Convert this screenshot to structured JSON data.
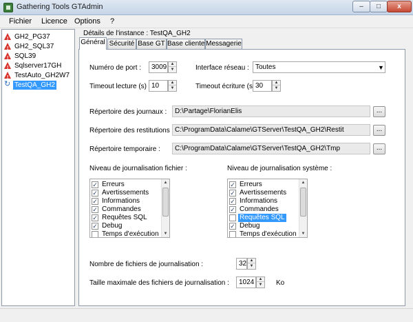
{
  "window": {
    "title": "Gathering Tools GTAdmin",
    "min": "–",
    "max": "□",
    "close": "x"
  },
  "menu": [
    "Fichier",
    "Licence",
    "Options",
    "?"
  ],
  "tree": [
    {
      "label": "GH2_PG37",
      "status": "warning"
    },
    {
      "label": "GH2_SQL37",
      "status": "warning"
    },
    {
      "label": "SQL39",
      "status": "warning"
    },
    {
      "label": "Sqlserver17GH",
      "status": "warning"
    },
    {
      "label": "TestAuto_GH2W7",
      "status": "warning"
    },
    {
      "label": "TestQA_GH2",
      "status": "refresh",
      "selected": true
    }
  ],
  "instance_title": "Détails de l'instance : TestQA_GH2",
  "tabs": [
    "Général",
    "Sécurité",
    "Base GT",
    "Base cliente",
    "Messagerie"
  ],
  "active_tab": "Général",
  "form": {
    "port": {
      "label": "Numéro de port :",
      "value": "3009"
    },
    "network": {
      "label": "Interface réseau :",
      "value": "Toutes"
    },
    "read_timeout": {
      "label": "Timeout lecture (s) :",
      "value": "10"
    },
    "write_timeout": {
      "label": "Timeout écriture (s) :",
      "value": "30"
    },
    "journal_dir": {
      "label": "Répertoire des journaux :",
      "value": "D:\\Partage\\FlorianElis"
    },
    "restit_dir": {
      "label": "Répertoire des restitutions :",
      "value": "C:\\ProgramData\\Calame\\GTServer\\TestQA_GH2\\Restit"
    },
    "temp_dir": {
      "label": "Répertoire temporaire :",
      "value": "C:\\ProgramData\\Calame\\GTServer\\TestQA_GH2\\Tmp"
    },
    "browse_label": "...",
    "file_log": {
      "title": "Niveau de journalisation fichier :",
      "items": [
        {
          "label": "Erreurs",
          "checked": true
        },
        {
          "label": "Avertissements",
          "checked": true
        },
        {
          "label": "Informations",
          "checked": true
        },
        {
          "label": "Commandes",
          "checked": true
        },
        {
          "label": "Requêtes SQL",
          "checked": true
        },
        {
          "label": "Debug",
          "checked": true
        },
        {
          "label": "Temps d'exécution",
          "checked": false
        }
      ]
    },
    "system_log": {
      "title": "Niveau de journalisation système :",
      "items": [
        {
          "label": "Erreurs",
          "checked": true
        },
        {
          "label": "Avertissements",
          "checked": true
        },
        {
          "label": "Informations",
          "checked": true
        },
        {
          "label": "Commandes",
          "checked": true
        },
        {
          "label": "Requêtes SQL",
          "checked": false,
          "highlighted": true
        },
        {
          "label": "Debug",
          "checked": true
        },
        {
          "label": "Temps d'exécution",
          "checked": false
        }
      ]
    },
    "log_file_count": {
      "label": "Nombre de fichiers de journalisation :",
      "value": "32"
    },
    "log_max_size": {
      "label": "Taille maximale des fichiers de journalisation :",
      "value": "1024",
      "unit": "Ko"
    }
  },
  "icons": {
    "warning": "warning-triangle-icon",
    "refresh": "refresh-icon",
    "dropdown": "chevron-down-icon"
  },
  "colors": {
    "selection": "#3399ff",
    "warning": "#d8322a"
  }
}
